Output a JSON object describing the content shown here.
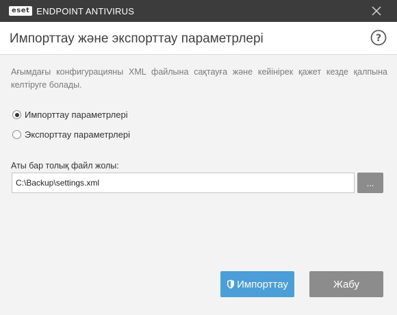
{
  "titlebar": {
    "logo_text": "eset",
    "app_name": "ENDPOINT ANTIVIRUS",
    "close_icon": "close-icon"
  },
  "header": {
    "title": "Импорттау және экспорттау параметрлері",
    "help_icon": "help-icon"
  },
  "description": "Ағымдағы конфигурацияны XML файлына сақтауға және кейінірек қажет кезде қалпына келтіруге болады.",
  "options": {
    "import_label": "Импорттау параметрлері",
    "export_label": "Экспорттау параметрлері",
    "selected": "import"
  },
  "path": {
    "label": "Аты бар толық файл жолы:",
    "value": "C:\\Backup\\settings.xml",
    "browse_label": "..."
  },
  "actions": {
    "import_label": "Импорттау",
    "import_icon": "shield-icon",
    "close_label": "Жабу"
  },
  "colors": {
    "titlebar": "#3c3c3c",
    "primary_button": "#4a9fd8",
    "secondary_button": "#8c8c8c"
  }
}
